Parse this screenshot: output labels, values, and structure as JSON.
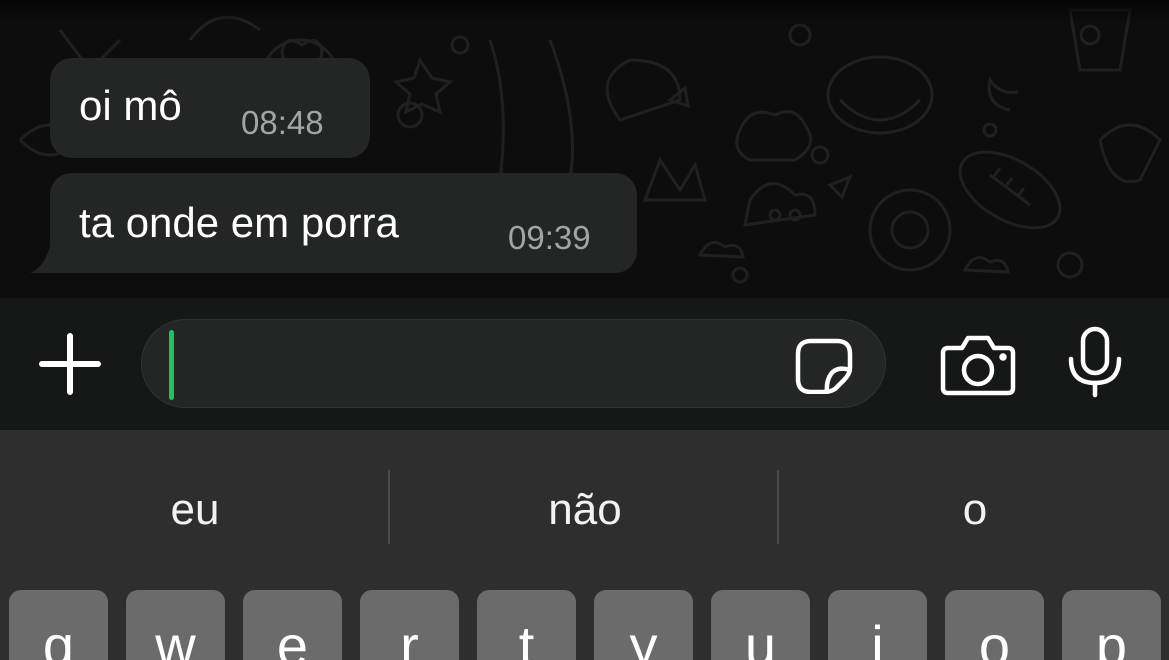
{
  "messages": [
    {
      "text": "oi mô",
      "time": "08:48"
    },
    {
      "text": "ta onde em porra",
      "time": "09:39"
    }
  ],
  "composer": {
    "value": "",
    "placeholder": ""
  },
  "keyboard": {
    "suggestions": [
      "eu",
      "não",
      "o"
    ],
    "keys_row_1": [
      "q",
      "w",
      "e",
      "r",
      "t",
      "y",
      "u",
      "i",
      "o",
      "p"
    ]
  },
  "icons": {
    "plus": "plus-icon",
    "sticker": "sticker-icon",
    "camera": "camera-icon",
    "mic": "microphone-icon"
  },
  "colors": {
    "caret": "#21c063",
    "bubble": "#242626",
    "background": "#0d0d0d",
    "keyboard": "#2e2e2e",
    "key": "#6b6b6b"
  }
}
